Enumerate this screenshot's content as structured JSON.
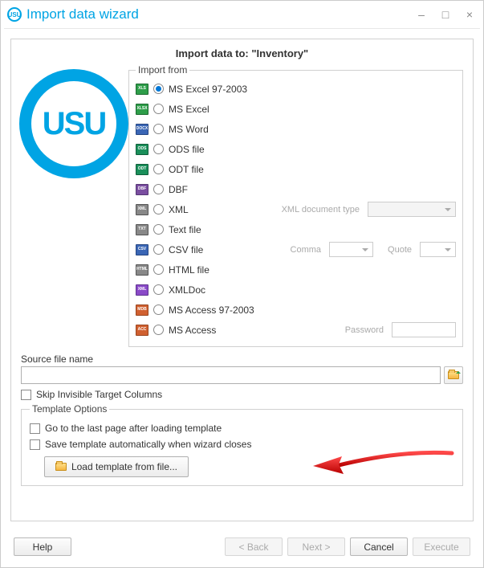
{
  "window": {
    "title": "Import data wizard",
    "heading": "Import data to: \"Inventory\""
  },
  "logo_text": "USU",
  "import_from": {
    "legend": "Import from",
    "selected": 0,
    "options": [
      {
        "icon": "XLS",
        "ic": "ic-xls",
        "label": "MS Excel 97-2003"
      },
      {
        "icon": "XLSX",
        "ic": "ic-xlsx",
        "label": "MS Excel"
      },
      {
        "icon": "DOCX",
        "ic": "ic-doc",
        "label": "MS Word"
      },
      {
        "icon": "ODS",
        "ic": "ic-ods",
        "label": "ODS file"
      },
      {
        "icon": "ODT",
        "ic": "ic-odt",
        "label": "ODT file"
      },
      {
        "icon": "DBF",
        "ic": "ic-dbf",
        "label": "DBF"
      },
      {
        "icon": "XML",
        "ic": "ic-xml",
        "label": "XML"
      },
      {
        "icon": "TXT",
        "ic": "ic-txt",
        "label": "Text file"
      },
      {
        "icon": "CSV",
        "ic": "ic-csv",
        "label": "CSV file"
      },
      {
        "icon": "HTML",
        "ic": "ic-html",
        "label": "HTML file"
      },
      {
        "icon": "XML",
        "ic": "ic-xmldoc",
        "label": "XMLDoc"
      },
      {
        "icon": "MDB",
        "ic": "ic-mdb",
        "label": "MS Access 97-2003"
      },
      {
        "icon": "ACC",
        "ic": "ic-accdb",
        "label": "MS Access"
      }
    ],
    "xml_doc_type_label": "XML document type",
    "comma_label": "Comma",
    "quote_label": "Quote",
    "password_label": "Password"
  },
  "source": {
    "label": "Source file name",
    "value": "",
    "skip_label": "Skip Invisible Target Columns"
  },
  "template": {
    "legend": "Template Options",
    "opt1": "Go to the last page after loading template",
    "opt2": "Save template automatically when wizard closes",
    "load_btn": "Load template from file..."
  },
  "footer": {
    "help": "Help",
    "back": "< Back",
    "next": "Next >",
    "cancel": "Cancel",
    "execute": "Execute"
  }
}
